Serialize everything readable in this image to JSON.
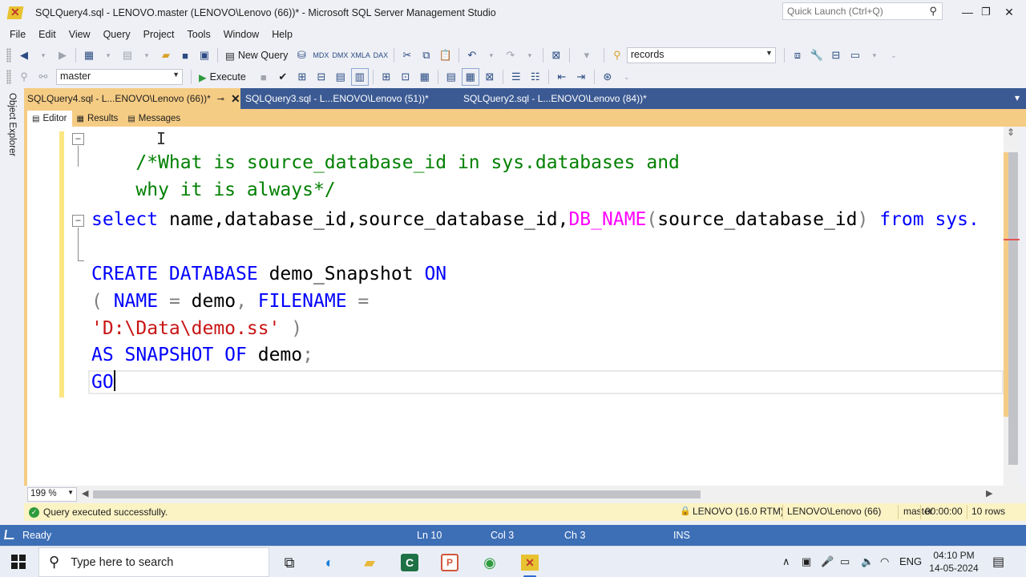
{
  "window": {
    "title": "SQLQuery4.sql - LENOVO.master (LENOVO\\Lenovo (66))* - Microsoft SQL Server Management Studio",
    "quick_launch_placeholder": "Quick Launch (Ctrl+Q)",
    "controls": [
      "minimize-icon",
      "restore-icon",
      "close-icon"
    ]
  },
  "menu": [
    "File",
    "Edit",
    "View",
    "Query",
    "Project",
    "Tools",
    "Window",
    "Help"
  ],
  "toolbar1": {
    "new_query_label": "New Query",
    "solution_config_value": "records"
  },
  "toolbar2": {
    "database_value": "master",
    "execute_label": "Execute"
  },
  "object_explorer_label": "Object Explorer",
  "doc_tabs": [
    {
      "label": "SQLQuery4.sql - L...ENOVO\\Lenovo (66))*",
      "active": true
    },
    {
      "label": "SQLQuery3.sql - L...ENOVO\\Lenovo (51))*",
      "active": false
    },
    {
      "label": "SQLQuery2.sql - L...ENOVO\\Lenovo (84))*",
      "active": false
    }
  ],
  "sub_tabs": [
    "Editor",
    "Results",
    "Messages"
  ],
  "code": {
    "l1_comment": "/*What is source_database_id in sys.databases and",
    "l2_comment": "why it is always*/",
    "l4_select": "select",
    "l4_cols": " name,database_id,source_database_id,",
    "l4_fn": "DB_NAME",
    "l4_paren_open": "(",
    "l4_arg": "source_database_id",
    "l4_paren_close": ")",
    "l4_from": " from",
    "l4_sys": " sys.",
    "l6_create": "CREATE DATABASE",
    "l6_name": " demo_Snapshot ",
    "l6_on": "ON",
    "l7_paren": "(",
    "l7_name_kw": " NAME",
    "l7_eq": " =",
    "l7_demo": " demo",
    "l7_comma": ",",
    "l7_filename_kw": " FILENAME",
    "l7_eq2": " =",
    "l8_str": "'D:\\Data\\demo.ss'",
    "l8_paren": " )",
    "l9_as": "AS SNAPSHOT OF",
    "l9_demo": " demo",
    "l9_semi": ";",
    "l10_go": "GO"
  },
  "editor": {
    "zoom": "199 %"
  },
  "query_status": {
    "message": "Query executed successfully.",
    "server": "LENOVO (16.0 RTM)",
    "user": "LENOVO\\Lenovo (66)",
    "database": "master",
    "elapsed": "00:00:00",
    "rows": "10 rows"
  },
  "status_bar": {
    "state": "Ready",
    "line": "Ln 10",
    "col": "Col 3",
    "ch": "Ch 3",
    "mode": "INS"
  },
  "taskbar": {
    "search_placeholder": "Type here to search",
    "apps": [
      "task-view-icon",
      "edge-icon",
      "file-explorer-icon",
      "excel-icon",
      "powerpoint-icon",
      "chrome-icon",
      "ssms-icon"
    ],
    "language": "ENG",
    "time": "04:10 PM",
    "date": "14-05-2024"
  },
  "colors": {
    "tab_active": "#f5cc84",
    "tab_bar": "#3b5a93",
    "status_bar": "#3d6fb6",
    "query_status_bg": "#fbf3c4"
  }
}
